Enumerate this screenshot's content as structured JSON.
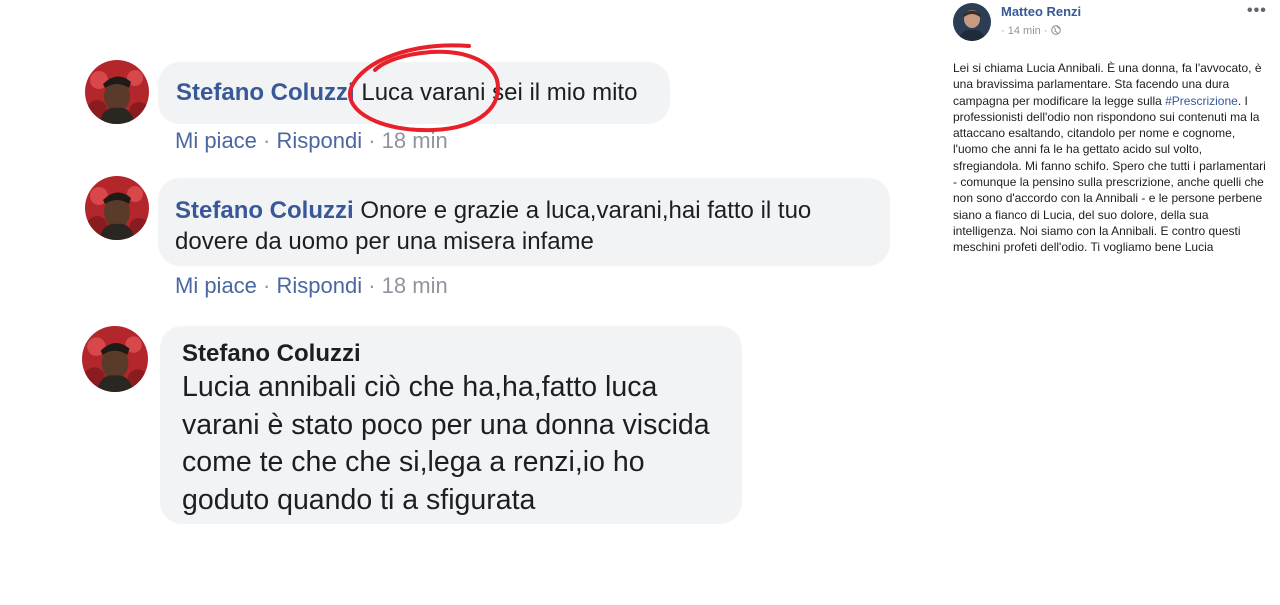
{
  "comments": [
    {
      "author": "Stefano Coluzzi",
      "text": "Luca varani sei il mio mito",
      "like": "Mi piace",
      "reply": "Rispondi",
      "sep": " · ",
      "time": "18 min"
    },
    {
      "author": "Stefano Coluzzi",
      "text": "Onore e grazie a luca,varani,hai fatto il tuo dovere da uomo per una misera infame",
      "like": "Mi piace",
      "reply": "Rispondi",
      "sep": " · ",
      "time": "18 min"
    },
    {
      "author": "Stefano Coluzzi",
      "text": "Lucia annibali ciò che ha,ha,fatto luca varani è stato poco per una donna viscida come te che che si,lega a renzi,io ho goduto quando ti a sfigurata"
    }
  ],
  "annotation": {
    "color": "#e8202a"
  },
  "post": {
    "author": "Matteo Renzi",
    "time": "14 min",
    "more": "•••",
    "body_before": "Lei si chiama Lucia Annibali. È una donna, fa l'avvocato, è una bravissima parlamentare. Sta facendo una dura campagna per modificare la legge sulla ",
    "hashtag": "#Prescrizione",
    "body_after": ". I professionisti dell'odio non rispondono sui contenuti ma la attaccano esaltando, citandolo per nome e cognome, l'uomo che anni fa le ha gettato acido sul volto, sfregiandola. Mi fanno schifo. Spero che tutti i parlamentari - comunque la pensino sulla prescrizione, anche quelli che non sono d'accordo con la Annibali - e le persone perbene siano a fianco di Lucia, del suo dolore, della sua intelligenza. Noi siamo con la Annibali. E contro questi meschini profeti dell'odio. Ti vogliamo bene Lucia"
  },
  "colors": {
    "link": "#385898",
    "bubble": "#f2f3f5",
    "meta": "#90949c"
  }
}
